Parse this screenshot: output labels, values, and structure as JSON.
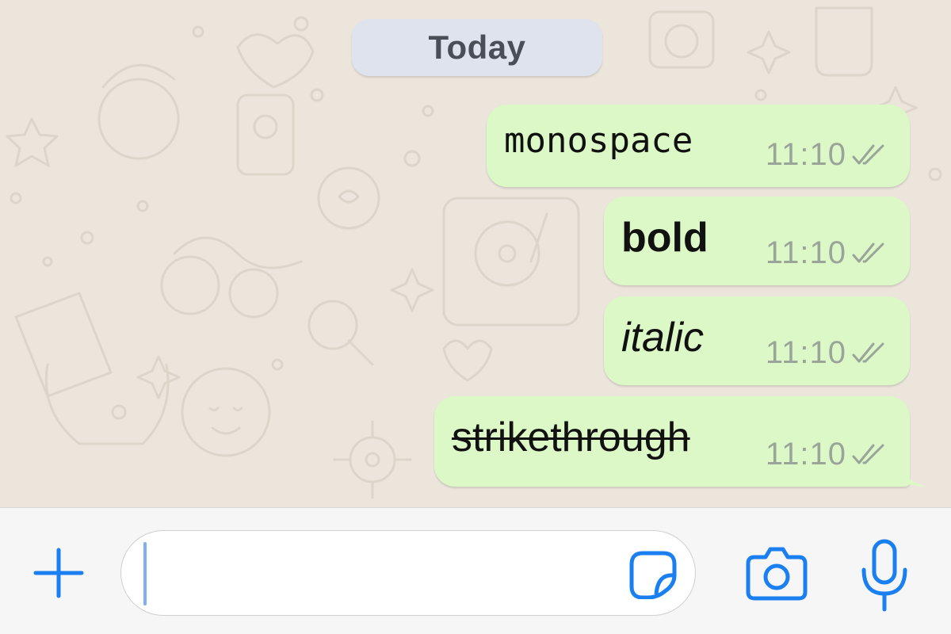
{
  "chat": {
    "date_label": "Today",
    "messages": [
      {
        "text": "monospace",
        "time": "11:10",
        "style": "monospace",
        "status": "read"
      },
      {
        "text": "bold",
        "time": "11:10",
        "style": "bold",
        "status": "read"
      },
      {
        "text": "italic",
        "time": "11:10",
        "style": "italic",
        "status": "read"
      },
      {
        "text": "strikethrough",
        "time": "11:10",
        "style": "strikethrough",
        "status": "read"
      }
    ]
  },
  "input_bar": {
    "message_value": "",
    "icons": {
      "add": "plus-icon",
      "sticker": "sticker-icon",
      "camera": "camera-icon",
      "voice": "microphone-icon"
    }
  },
  "colors": {
    "accent": "#1a7ff0",
    "bubble_outgoing": "#dcf8c6",
    "date_pill": "#dfe3ee",
    "chat_background": "#ebe5dc",
    "timestamp": "#9aa59a",
    "input_bar_background": "#f6f6f6"
  }
}
